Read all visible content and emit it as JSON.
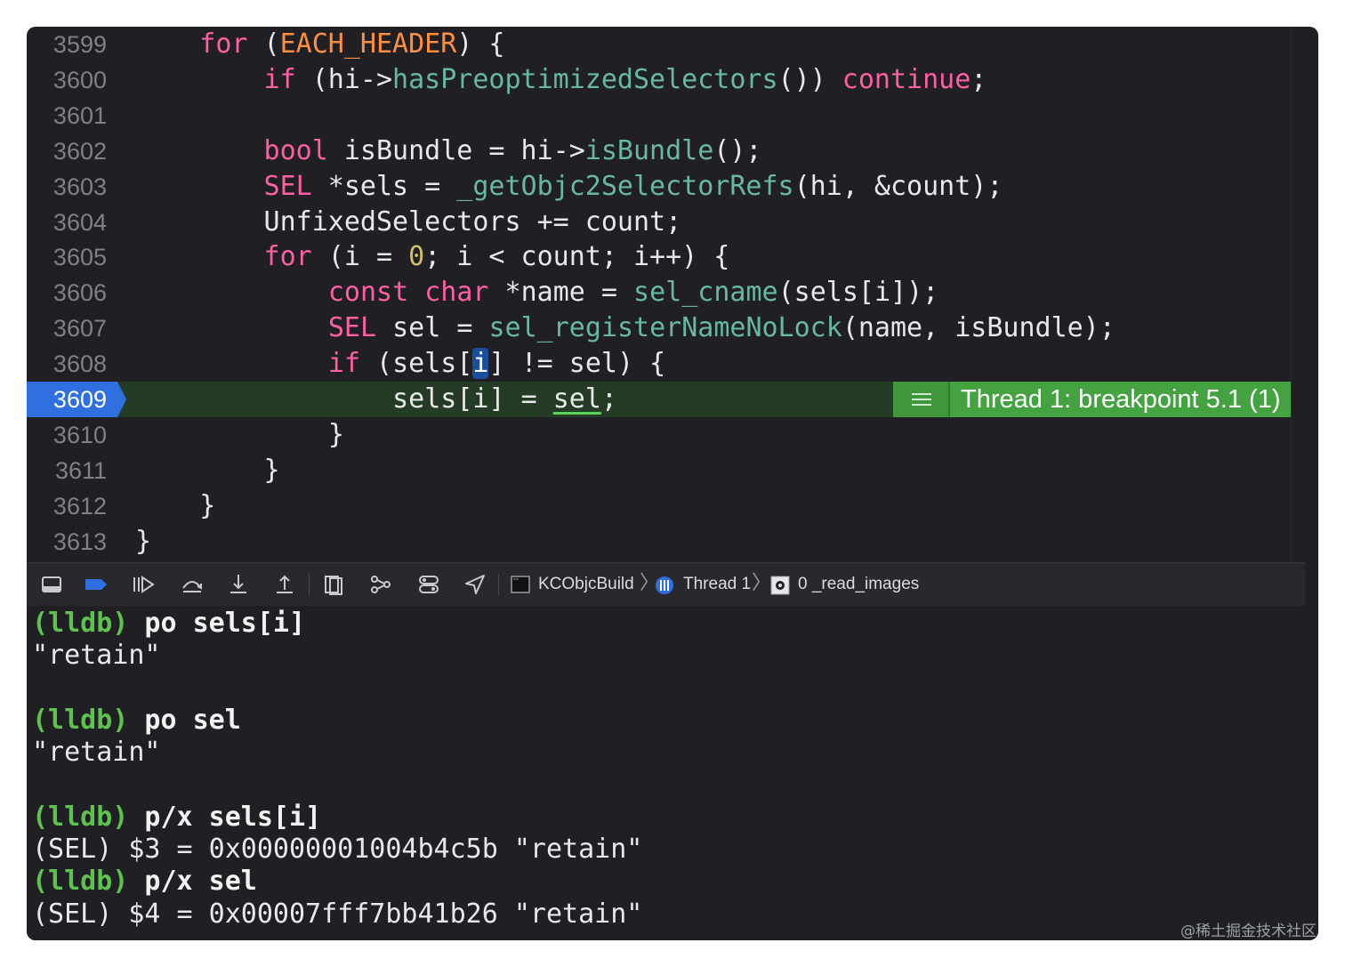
{
  "editor": {
    "lines": [
      {
        "num": "3599",
        "indent": 4,
        "tokens": [
          [
            "kw",
            "for"
          ],
          [
            "p",
            " ("
          ],
          [
            "mc",
            "EACH_HEADER"
          ],
          [
            "p",
            ") {"
          ]
        ]
      },
      {
        "num": "3600",
        "indent": 8,
        "tokens": [
          [
            "kw",
            "if"
          ],
          [
            "p",
            " (hi->"
          ],
          [
            "fn",
            "hasPreoptimizedSelectors"
          ],
          [
            "p",
            "()) "
          ],
          [
            "kw",
            "continue"
          ],
          [
            "p",
            ";"
          ]
        ]
      },
      {
        "num": "3601",
        "indent": 0,
        "tokens": []
      },
      {
        "num": "3602",
        "indent": 8,
        "tokens": [
          [
            "kw",
            "bool"
          ],
          [
            "p",
            " isBundle = hi->"
          ],
          [
            "fn",
            "isBundle"
          ],
          [
            "p",
            "();"
          ]
        ]
      },
      {
        "num": "3603",
        "indent": 8,
        "tokens": [
          [
            "kw",
            "SEL"
          ],
          [
            "p",
            " *sels = "
          ],
          [
            "fn",
            "_getObjc2SelectorRefs"
          ],
          [
            "p",
            "(hi, &count);"
          ]
        ]
      },
      {
        "num": "3604",
        "indent": 8,
        "tokens": [
          [
            "p",
            "UnfixedSelectors += count;"
          ]
        ]
      },
      {
        "num": "3605",
        "indent": 8,
        "tokens": [
          [
            "kw",
            "for"
          ],
          [
            "p",
            " (i = "
          ],
          [
            "num",
            "0"
          ],
          [
            "p",
            "; i < count; i++) {"
          ]
        ]
      },
      {
        "num": "3606",
        "indent": 12,
        "tokens": [
          [
            "kw",
            "const"
          ],
          [
            "p",
            " "
          ],
          [
            "kw",
            "char"
          ],
          [
            "p",
            " *name = "
          ],
          [
            "fn",
            "sel_cname"
          ],
          [
            "p",
            "(sels[i]);"
          ]
        ]
      },
      {
        "num": "3607",
        "indent": 12,
        "tokens": [
          [
            "kw",
            "SEL"
          ],
          [
            "p",
            " sel = "
          ],
          [
            "fn",
            "sel_registerNameNoLock"
          ],
          [
            "p",
            "(name, isBundle);"
          ]
        ]
      },
      {
        "num": "3608",
        "indent": 12,
        "tokens": [
          [
            "kw",
            "if"
          ],
          [
            "p",
            " (sels["
          ],
          [
            "hl",
            "i"
          ],
          [
            "p",
            "] != sel) {"
          ]
        ]
      },
      {
        "num": "3609",
        "indent": 16,
        "current": true,
        "tokens": [
          [
            "p",
            "sels[i] = "
          ],
          [
            "ul",
            "sel"
          ],
          [
            "p",
            ";"
          ]
        ]
      },
      {
        "num": "3610",
        "indent": 12,
        "tokens": [
          [
            "p",
            "}"
          ]
        ]
      },
      {
        "num": "3611",
        "indent": 8,
        "tokens": [
          [
            "p",
            "}"
          ]
        ]
      },
      {
        "num": "3612",
        "indent": 4,
        "tokens": [
          [
            "p",
            "}"
          ]
        ]
      },
      {
        "num": "3613",
        "indent": 0,
        "tokens": [
          [
            "p",
            "}"
          ]
        ]
      }
    ],
    "breakpoint_label": "Thread 1: breakpoint 5.1 (1)"
  },
  "debugbar": {
    "target": "KCObjcBuild",
    "thread": "Thread 1",
    "frame": "0 _read_images"
  },
  "console": {
    "entries": [
      {
        "prompt": "(lldb)",
        "command": " po sels[i]"
      },
      {
        "output": "\"retain\""
      },
      {
        "output": ""
      },
      {
        "prompt": "(lldb)",
        "command": " po sel"
      },
      {
        "output": "\"retain\""
      },
      {
        "output": ""
      },
      {
        "prompt": "(lldb)",
        "command": " p/x sels[i]"
      },
      {
        "output": "(SEL) $3 = 0x00000001004b4c5b \"retain\""
      },
      {
        "prompt": "(lldb)",
        "command": " p/x sel"
      },
      {
        "output": "(SEL) $4 = 0x00007fff7bb41b26 \"retain\""
      }
    ]
  },
  "watermark": "@稀土掘金技术社区",
  "colors": {
    "keyword": "#fc5fa3",
    "macro": "#fd8f3f",
    "function": "#67b7a4",
    "number": "#d0bf69",
    "breakpoint_green": "#44a340",
    "line_marker_blue": "#2f6fe0",
    "prompt_green": "#5ec24f"
  }
}
